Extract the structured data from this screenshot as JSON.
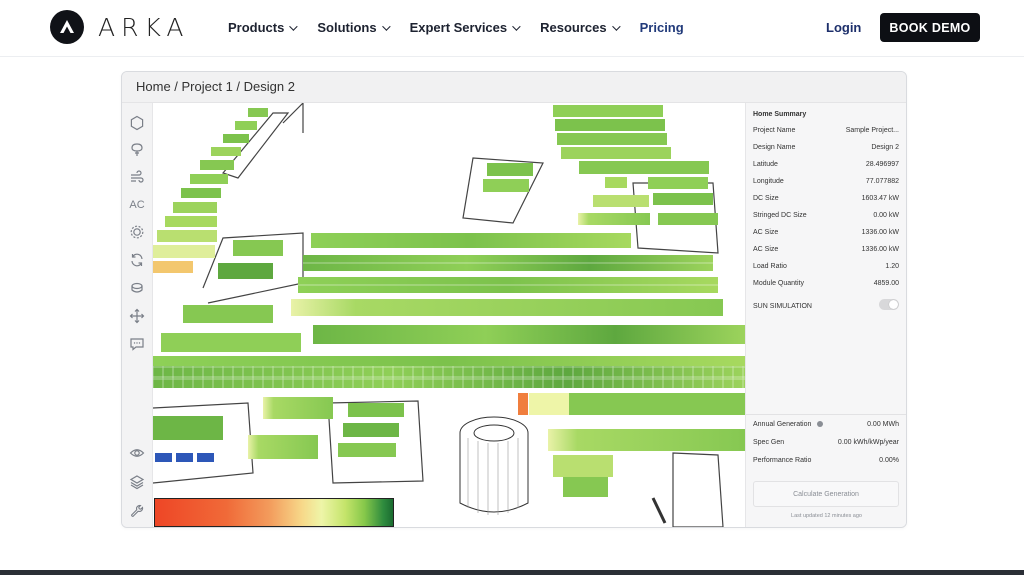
{
  "brand": {
    "name": "ARKA"
  },
  "nav": {
    "items": [
      {
        "label": "Products",
        "dropdown": true
      },
      {
        "label": "Solutions",
        "dropdown": true
      },
      {
        "label": "Expert Services",
        "dropdown": true
      },
      {
        "label": "Resources",
        "dropdown": true
      },
      {
        "label": "Pricing",
        "dropdown": false
      }
    ],
    "login": "Login",
    "demo": "BOOK DEMO"
  },
  "app": {
    "breadcrumb": "Home / Project 1 / Design 2",
    "tools": [
      {
        "icon": "hexagon-icon"
      },
      {
        "icon": "tree-icon"
      },
      {
        "icon": "wind-icon"
      },
      {
        "icon": "ac-text-icon",
        "label": "AC"
      },
      {
        "icon": "sun-gear-icon"
      },
      {
        "icon": "refresh-icon"
      },
      {
        "icon": "terrain-icon"
      },
      {
        "icon": "move-icon"
      },
      {
        "icon": "comment-icon"
      },
      {
        "icon": "eye-icon"
      },
      {
        "icon": "layers-icon"
      },
      {
        "icon": "wrench-icon"
      }
    ],
    "panel": {
      "title": "Home Summary",
      "rows": [
        {
          "label": "Project Name",
          "value": "Sample Project..."
        },
        {
          "label": "Design Name",
          "value": "Design 2"
        },
        {
          "label": "Latitude",
          "value": "28.496997"
        },
        {
          "label": "Longitude",
          "value": "77.077882"
        },
        {
          "label": "DC Size",
          "value": "1603.47 kW"
        },
        {
          "label": "Stringed DC Size",
          "value": "0.00 kW"
        },
        {
          "label": "AC Size",
          "value": "1336.00 kW"
        },
        {
          "label": "AC Size",
          "value": "1336.00 kW"
        },
        {
          "label": "Load Ratio",
          "value": "1.20"
        },
        {
          "label": "Module Quantity",
          "value": "4859.00"
        }
      ],
      "sun_simulation": "SUN SIMULATION",
      "sun_simulation_on": false,
      "generation": [
        {
          "label": "Annual Generation",
          "value": "0.00 MWh"
        },
        {
          "label": "Spec Gen",
          "value": "0.00 kWh/kWp/year"
        },
        {
          "label": "Performance Ratio",
          "value": "0.00%"
        }
      ],
      "calculate_button": "Calculate Generation",
      "last_updated": "Last updated 12 minutes ago"
    }
  },
  "colors": {
    "accent_dark": "#0d0f14",
    "pricing_link": "#213a7a",
    "panel_low": "#ee4626",
    "panel_high": "#1a6b30"
  }
}
